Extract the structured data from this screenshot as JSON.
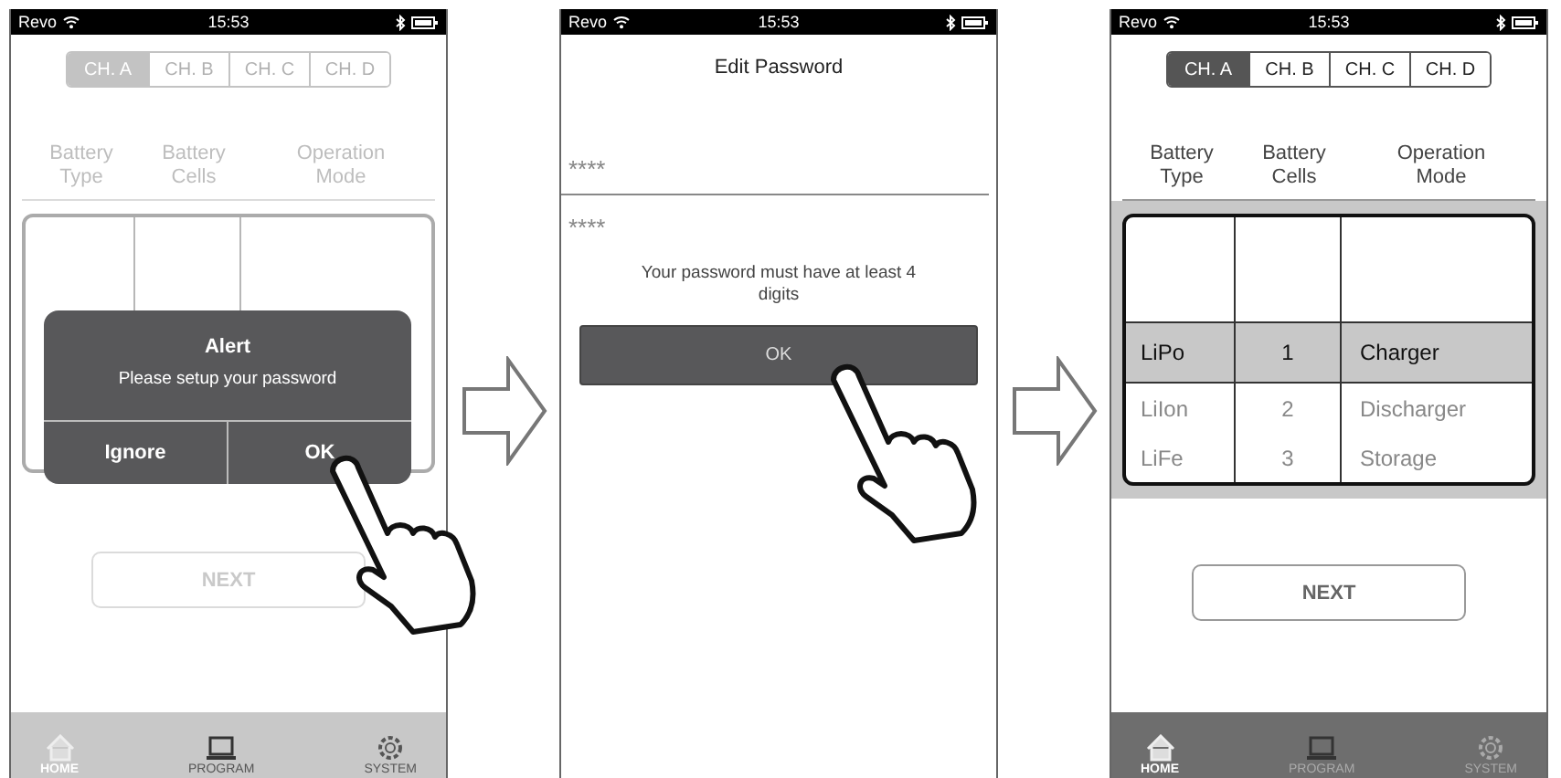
{
  "screens": [
    {
      "kind": "home",
      "dimmed": true,
      "touch": true,
      "status": {
        "carrier": "Revo",
        "time": "15:53"
      },
      "channels": [
        {
          "label": "CH. A",
          "selected": true
        },
        {
          "label": "CH. B",
          "selected": false
        },
        {
          "label": "CH. C",
          "selected": false
        },
        {
          "label": "CH. D",
          "selected": false
        }
      ],
      "headers": [
        "Battery Type",
        "Battery Cells",
        "Operation Mode"
      ],
      "picker": {
        "highlighted": false
      },
      "alert": {
        "title": "Alert",
        "message": "Please setup your password",
        "buttons": [
          "Ignore",
          "OK"
        ]
      },
      "next": "NEXT",
      "tabbar": [
        {
          "label": "HOME",
          "selected": true
        },
        {
          "label": "PROGRAM",
          "selected": false
        },
        {
          "label": "SYSTEM",
          "selected": false
        }
      ]
    },
    {
      "kind": "password",
      "touch": true,
      "status": {
        "carrier": "Revo",
        "time": "15:53"
      },
      "title": "Edit Password",
      "fields": [
        {
          "value": "****"
        },
        {
          "value": "****"
        }
      ],
      "hint": "Your password must have at least 4 digits",
      "button": "OK"
    },
    {
      "kind": "home",
      "dimmed": false,
      "touch": false,
      "status": {
        "carrier": "Revo",
        "time": "15:53"
      },
      "channels": [
        {
          "label": "CH. A",
          "selected": true
        },
        {
          "label": "CH. B",
          "selected": false
        },
        {
          "label": "CH. C",
          "selected": false
        },
        {
          "label": "CH. D",
          "selected": false
        }
      ],
      "headers": [
        "Battery Type",
        "Battery Cells",
        "Operation Mode"
      ],
      "picker": {
        "highlighted": true,
        "rows": [
          {
            "cells": [
              "LiPo",
              "1",
              "Charger"
            ],
            "selected": true
          },
          {
            "cells": [
              "LiIon",
              "2",
              "Discharger"
            ],
            "selected": false
          },
          {
            "cells": [
              "LiFe",
              "3",
              "Storage"
            ],
            "selected": false
          }
        ]
      },
      "next": "NEXT",
      "tabbar": [
        {
          "label": "HOME",
          "selected": true
        },
        {
          "label": "PROGRAM",
          "selected": false
        },
        {
          "label": "SYSTEM",
          "selected": false
        }
      ]
    }
  ]
}
